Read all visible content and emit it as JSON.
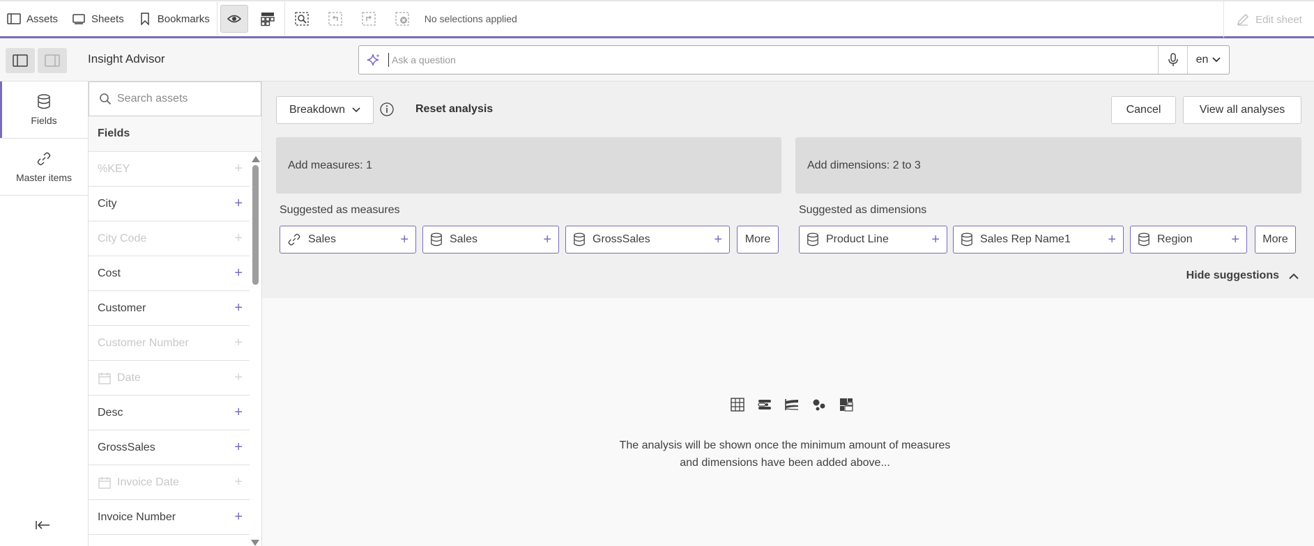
{
  "toolbar": {
    "assets_label": "Assets",
    "sheets_label": "Sheets",
    "bookmarks_label": "Bookmarks",
    "no_selections": "No selections applied",
    "edit_sheet": "Edit sheet"
  },
  "header": {
    "title": "Insight Advisor",
    "ask_placeholder": "Ask a question",
    "language": "en"
  },
  "rail": {
    "fields_label": "Fields",
    "master_items_label": "Master items"
  },
  "assets": {
    "search_placeholder": "Search assets",
    "fields_heading": "Fields",
    "fields": [
      {
        "name": "%KEY",
        "disabled": true,
        "calendar": false
      },
      {
        "name": "City",
        "disabled": false,
        "calendar": false
      },
      {
        "name": "City Code",
        "disabled": true,
        "calendar": false
      },
      {
        "name": "Cost",
        "disabled": false,
        "calendar": false
      },
      {
        "name": "Customer",
        "disabled": false,
        "calendar": false
      },
      {
        "name": "Customer Number",
        "disabled": true,
        "calendar": false
      },
      {
        "name": "Date",
        "disabled": true,
        "calendar": true
      },
      {
        "name": "Desc",
        "disabled": false,
        "calendar": false
      },
      {
        "name": "GrossSales",
        "disabled": false,
        "calendar": false
      },
      {
        "name": "Invoice Date",
        "disabled": true,
        "calendar": true
      },
      {
        "name": "Invoice Number",
        "disabled": false,
        "calendar": false
      }
    ]
  },
  "analysis": {
    "type_label": "Breakdown",
    "reset_label": "Reset analysis",
    "cancel_label": "Cancel",
    "view_all_label": "View all analyses",
    "add_measures": "Add measures: 1",
    "add_dimensions": "Add dimensions: 2 to 3",
    "suggested_measures_title": "Suggested as measures",
    "suggested_dimensions_title": "Suggested as dimensions",
    "suggested_measures": [
      {
        "label": "Sales",
        "icon": "link-icon"
      },
      {
        "label": "Sales",
        "icon": "database-icon"
      },
      {
        "label": "GrossSales",
        "icon": "database-icon"
      }
    ],
    "suggested_dimensions": [
      {
        "label": "Product Line",
        "icon": "database-icon"
      },
      {
        "label": "Sales Rep Name1",
        "icon": "database-icon"
      },
      {
        "label": "Region",
        "icon": "database-icon"
      }
    ],
    "more_label": "More",
    "hide_suggestions": "Hide suggestions",
    "empty_line1": "The analysis will be shown once the minimum amount of measures",
    "empty_line2": "and dimensions have been added above..."
  },
  "colors": {
    "accent": "#7b6bbd",
    "drop_zone": "#dcdcdc"
  }
}
